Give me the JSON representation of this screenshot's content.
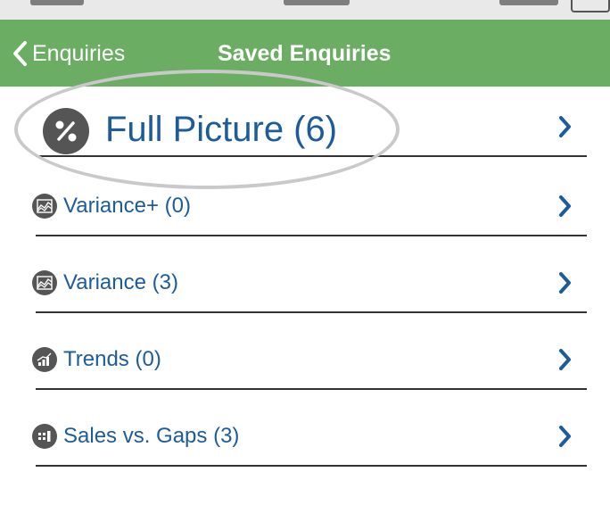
{
  "nav": {
    "back_label": "Enquiries",
    "title": "Saved Enquiries",
    "background": "#6aad63"
  },
  "items": [
    {
      "label": "Full Picture (6)",
      "icon": "percent-icon"
    },
    {
      "label": "Variance+ (0)",
      "icon": "area-chart-icon"
    },
    {
      "label": "Variance (3)",
      "icon": "area-chart-icon"
    },
    {
      "label": "Trends (0)",
      "icon": "trend-bars-icon"
    },
    {
      "label": "Sales vs. Gaps (3)",
      "icon": "bar-grid-icon"
    }
  ],
  "colors": {
    "label": "#1d5c9a",
    "chevron": "#1d5c9a",
    "icon_bg": "#555555",
    "highlight": "#c9c9c9"
  }
}
